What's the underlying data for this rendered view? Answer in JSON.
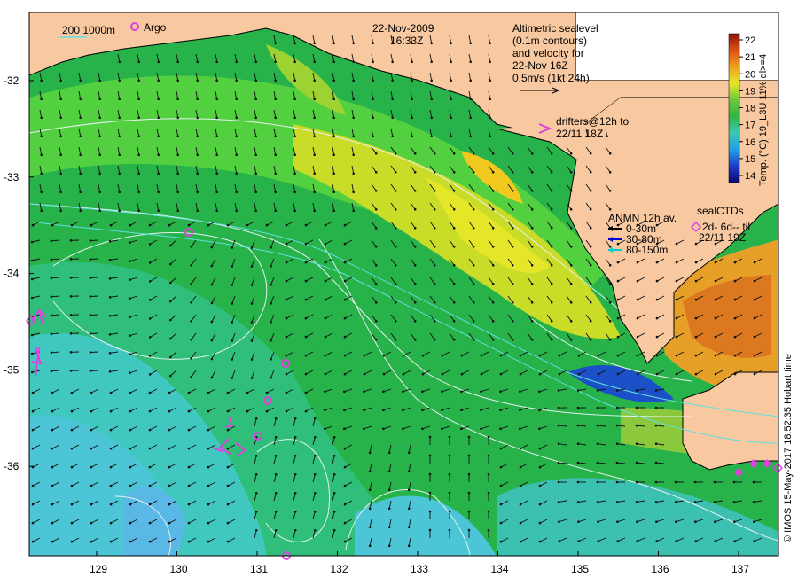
{
  "header": {
    "date": "22-Nov-2009",
    "time": "16:33Z"
  },
  "legend": {
    "isobath_label": "200  1000m",
    "argo_label": "Argo",
    "altimetry_lines": [
      "Altimetric sealevel",
      "(0.1m contours)",
      "and velocity for",
      "22-Nov 16Z",
      "0.5m/s (1kt 24h)"
    ],
    "drifters_lines": [
      "drifters@12h to",
      "22/11 18Z"
    ],
    "anmn_title": "ANMN 12h av.",
    "anmn_items": [
      {
        "label": "0-30m",
        "color": "#000000"
      },
      {
        "label": "30-80m",
        "color": "#0000cc"
      },
      {
        "label": "80-150m",
        "color": "#00cccc"
      }
    ],
    "sealctd_lines": [
      "sealCTDs",
      "2d- 6d-- til",
      "22/11 19Z"
    ],
    "marker_color": "#e040e0"
  },
  "colorbar": {
    "label": "Temp. (°C) 19_L3U 11% ql>=4",
    "ticks": [
      "14",
      "15",
      "16",
      "17",
      "18",
      "19",
      "20",
      "21",
      "22"
    ],
    "stops": [
      "#0a0a6e",
      "#1e3cc8",
      "#20a0e6",
      "#3cc8b4",
      "#30b446",
      "#6ec83c",
      "#e6e628",
      "#f0a01e",
      "#dc5014",
      "#8c140a"
    ]
  },
  "axes": {
    "lon_ticks": [
      "129",
      "130",
      "131",
      "132",
      "133",
      "134",
      "135",
      "136",
      "137"
    ],
    "lat_ticks": [
      "-32",
      "-33",
      "-34",
      "-35",
      "-36"
    ]
  },
  "credit": "© IMOS 15-May-2017 18:52:35 Hobart time"
}
